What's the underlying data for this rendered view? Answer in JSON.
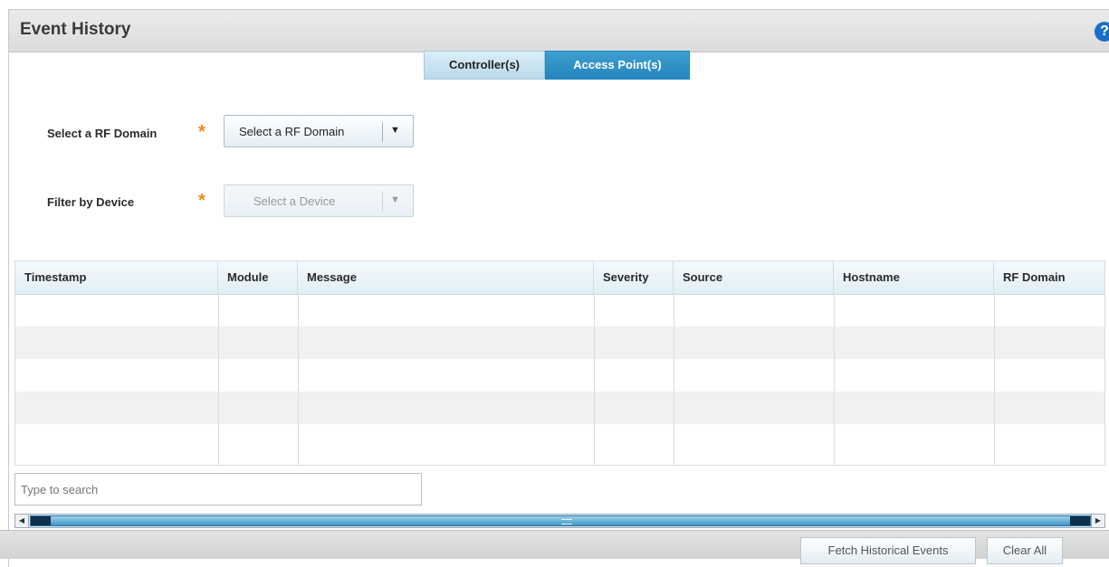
{
  "panel": {
    "title": "Event History",
    "help_glyph": "?"
  },
  "tabs": [
    {
      "label": "Controller(s)",
      "active": false
    },
    {
      "label": "Access Point(s)",
      "active": true
    }
  ],
  "form": {
    "rf_domain": {
      "label": "Select a RF Domain",
      "value": "Select a RF Domain",
      "required_mark": "*"
    },
    "device": {
      "label": "Filter by Device",
      "value": "Select a Device",
      "required_mark": "*",
      "disabled": true
    }
  },
  "table": {
    "columns": [
      "Timestamp",
      "Module",
      "Message",
      "Severity",
      "Source",
      "Hostname",
      "RF Domain"
    ],
    "rows": []
  },
  "search": {
    "placeholder": "Type to search",
    "value": ""
  },
  "footer": {
    "fetch_label": "Fetch Historical Events",
    "clear_label": "Clear All"
  },
  "icons": {
    "dropdown_arrow": "chevron-down-icon",
    "help": "help-icon",
    "required": "asterisk-icon"
  },
  "colors": {
    "accent": "#2486bc",
    "required": "#f08a1c",
    "help": "#1a6fc9"
  }
}
